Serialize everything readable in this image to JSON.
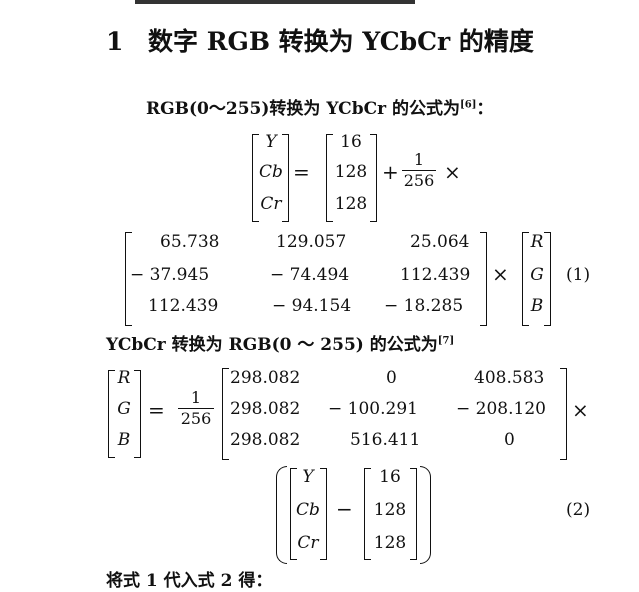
{
  "section": {
    "number": "1",
    "title": "数字 RGB 转换为 YCbCr 的精度"
  },
  "paragraph1": {
    "text": "RGB(0～255)转换为 YCbCr 的公式为",
    "ref": "[6]",
    "tail": "："
  },
  "eq1": {
    "lhs": [
      "Y",
      "Cb",
      "Cr"
    ],
    "offset": [
      "16",
      "128",
      "128"
    ],
    "plus": "+",
    "equals": "=",
    "times": "×",
    "frac_num": "1",
    "frac_den": "256",
    "matrix": [
      [
        "65.738",
        "129.057",
        "25.064"
      ],
      [
        "− 37.945",
        "− 74.494",
        "112.439"
      ],
      [
        "112.439",
        "− 94.154",
        "− 18.285"
      ]
    ],
    "rgb": [
      "R",
      "G",
      "B"
    ],
    "number": "(1)"
  },
  "paragraph2": {
    "text": "YCbCr 转换为 RGB(0 ～ 255) 的公式为",
    "ref": "[7]"
  },
  "eq2": {
    "lhs": [
      "R",
      "G",
      "B"
    ],
    "equals": "=",
    "frac_num": "1",
    "frac_den": "256",
    "matrix": [
      [
        "298.082",
        "0",
        "408.583"
      ],
      [
        "298.082",
        "− 100.291",
        "− 208.120"
      ],
      [
        "298.082",
        "516.411",
        "0"
      ]
    ],
    "times": "×",
    "ycc": [
      "Y",
      "Cb",
      "Cr"
    ],
    "minus": "−",
    "offset": [
      "16",
      "128",
      "128"
    ],
    "number": "(2)"
  },
  "paragraph3": {
    "text": "将式 1 代入式 2 得："
  }
}
